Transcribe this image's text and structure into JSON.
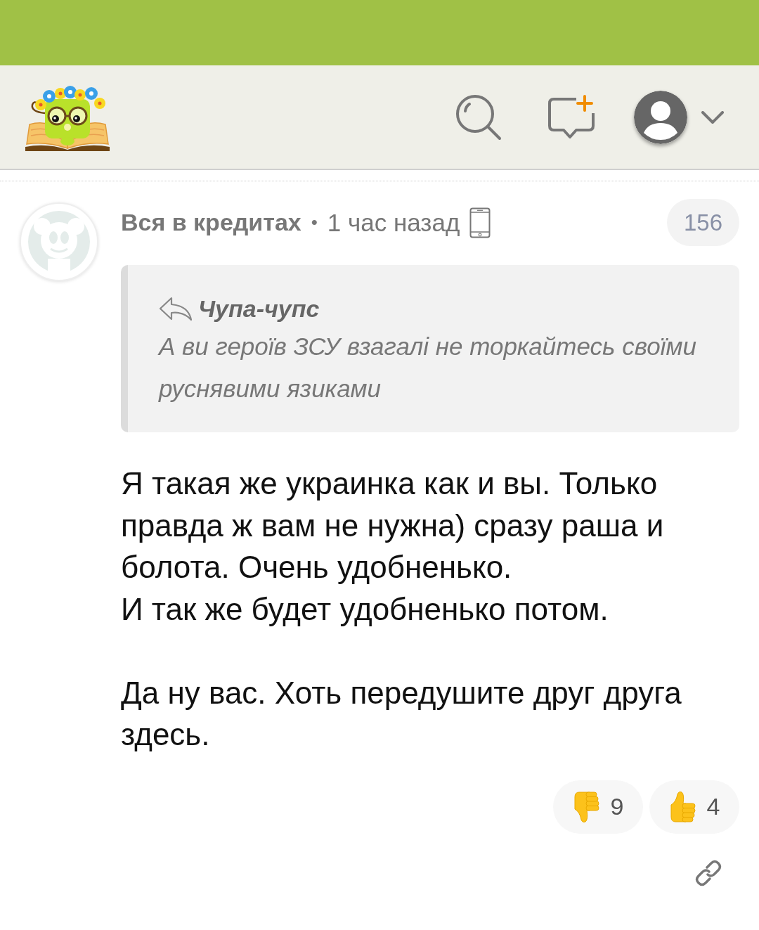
{
  "comment": {
    "author": "Вся в кредитах",
    "separator": "•",
    "time": "1 час назад",
    "rating": "156",
    "quote": {
      "author": "Чупа-чупс",
      "text": "А ви героїв ЗСУ взагалі не торкайтесь своїми руснявими язиками"
    },
    "body": "Я такая же украинка как и вы. Только правда ж вам не нужна) сразу раша и болота. Очень удобненько.\nИ так же будет удобненько потом.\n\nДа ну вас. Хоть передушите друг друга здесь.",
    "reactions": [
      {
        "kind": "dislike",
        "count": "9"
      },
      {
        "kind": "like",
        "count": "4"
      }
    ]
  }
}
